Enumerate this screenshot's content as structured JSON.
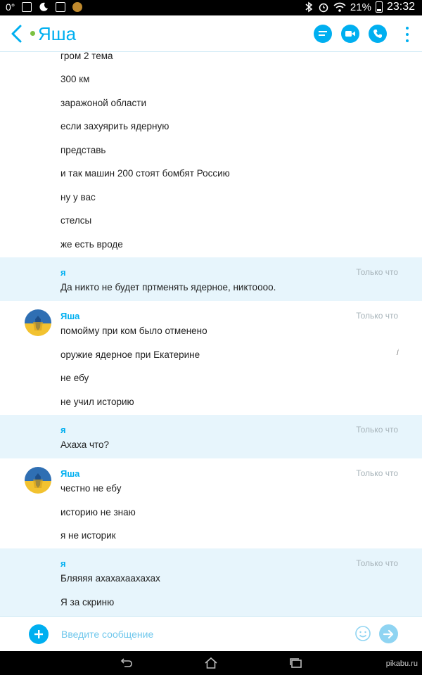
{
  "status_bar": {
    "left_text": "0°",
    "battery_percent": "21%",
    "time": "23:32",
    "icons": [
      "gmail-icon",
      "moon-icon",
      "image-icon",
      "app-icon"
    ],
    "right_icons": [
      "bluetooth-icon",
      "alarm-icon",
      "wifi-icon",
      "battery-icon"
    ]
  },
  "header": {
    "back_icon": "chevron-left-icon",
    "contact_name": "Яша",
    "presence": "online",
    "actions": [
      "chat-list-icon",
      "video-call-icon",
      "phone-call-icon",
      "more-vert-icon"
    ],
    "accent_color": "#00aff0"
  },
  "messages": {
    "block1": {
      "lines": [
        "гром 2 тема",
        "300 км",
        "заражоной области",
        "если захуярить ядерную",
        "представь",
        "и так машин 200 стоят бомбят Россию",
        "ну у вас",
        "стелсы",
        "же есть вроде"
      ]
    },
    "block2": {
      "sender": "я",
      "timestamp": "Только что",
      "lines": [
        "Да никто не будет пртменять ядерное, никтоооо."
      ]
    },
    "block3": {
      "sender": "Яша",
      "timestamp": "Только что",
      "edit_mark": "ʲ",
      "lines": [
        "помойму при ком было отменено",
        "оружие ядерное при Екатерине",
        "не ебу",
        "не учил историю"
      ]
    },
    "block4": {
      "sender": "я",
      "timestamp": "Только что",
      "lines": [
        "Ахаха что?"
      ]
    },
    "block5": {
      "sender": "Яша",
      "timestamp": "Только что",
      "lines": [
        "честно не ебу",
        "историю не знаю",
        "я не историк"
      ]
    },
    "block6": {
      "sender": "я",
      "timestamp": "Только что",
      "lines": [
        "Бляяяя ахахахаахахах",
        "Я за скриню"
      ]
    }
  },
  "input_bar": {
    "placeholder": "Введите сообщение",
    "add_icon": "plus-icon",
    "emoji_icon": "smiley-icon",
    "send_icon": "arrow-right-icon"
  },
  "nav_bar": {
    "buttons": [
      "back-nav-icon",
      "home-nav-icon",
      "recents-nav-icon"
    ]
  },
  "watermark": "pikabu.ru"
}
